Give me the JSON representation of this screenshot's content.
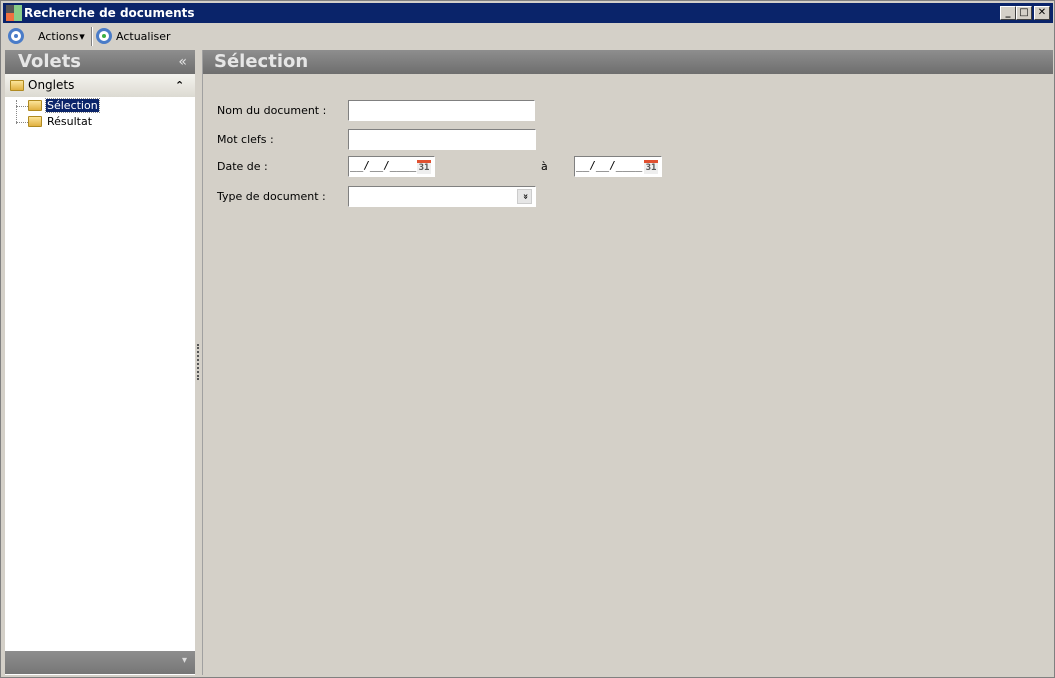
{
  "window": {
    "title": "Recherche de documents",
    "minimize": "_",
    "maximize": "□",
    "close": "✕"
  },
  "toolbar": {
    "actions_label": "Actions",
    "actions_arrow": "▾",
    "refresh_label": "Actualiser"
  },
  "left_panel": {
    "title": "Volets",
    "collapse_glyph": "«",
    "group_label": "Onglets",
    "group_toggle": "⌃",
    "items": [
      {
        "label": "Sélection",
        "selected": true
      },
      {
        "label": "Résultat",
        "selected": false
      }
    ],
    "footer_arrow": "▾"
  },
  "main": {
    "title": "Sélection",
    "form": {
      "doc_name_label": "Nom du document :",
      "doc_name_value": "",
      "keywords_label": "Mot clefs :",
      "keywords_value": "",
      "date_from_label": "Date de :",
      "date_from_value": "__/__/____",
      "date_to_label": "à",
      "date_to_value": "__/__/____",
      "calendar_glyph": "31",
      "doc_type_label": "Type de document :",
      "doc_type_value": "",
      "dropdown_glyph": "»"
    }
  }
}
